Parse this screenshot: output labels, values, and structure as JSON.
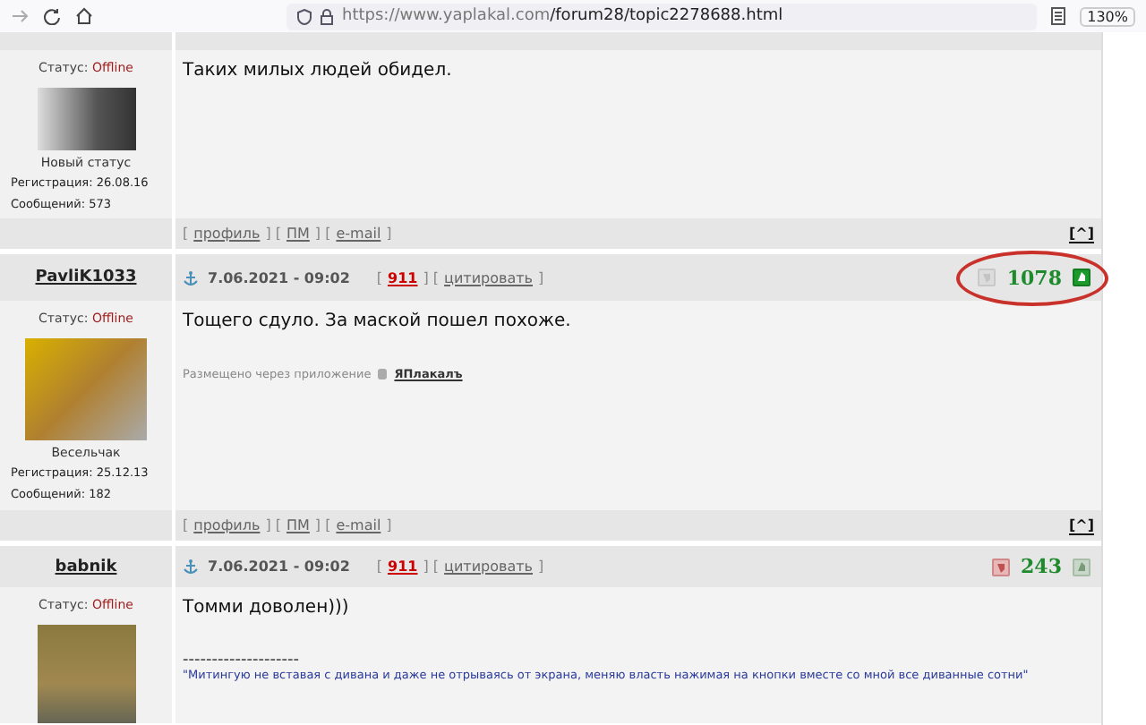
{
  "browser": {
    "url_host": "https://www.yaplakal.com",
    "url_path": "/forum28/topic2278688.html",
    "zoom": "130%"
  },
  "posts": [
    {
      "status_label": "Статус:",
      "status": "Offline",
      "avatar_caption": "Новый статус",
      "registration": "Регистрация: 26.08.16",
      "messages": "Сообщений: 573",
      "body": "Таких милых людей обидел.",
      "footer": [
        {
          "kind": "text",
          "text": "["
        },
        {
          "kind": "link",
          "text": "профиль"
        },
        {
          "kind": "text",
          "text": "] ["
        },
        {
          "kind": "link",
          "text": "ПМ"
        },
        {
          "kind": "text",
          "text": "] ["
        },
        {
          "kind": "link",
          "text": "e-mail"
        },
        {
          "kind": "text",
          "text": "]"
        }
      ],
      "top_button": "[^]"
    },
    {
      "author": "PavliK1033",
      "date": "7.06.2021 - 09:02",
      "header_links": [
        {
          "kind": "text",
          "text": "["
        },
        {
          "kind": "number",
          "text": "911"
        },
        {
          "kind": "text",
          "text": "] ["
        },
        {
          "kind": "link",
          "text": "цитировать"
        },
        {
          "kind": "text",
          "text": "]"
        }
      ],
      "rating": "1078",
      "voted_up": true,
      "circled": true,
      "status_label": "Статус:",
      "status": "Offline",
      "avatar_caption": "Весельчак",
      "registration": "Регистрация: 25.12.13",
      "messages": "Сообщений: 182",
      "body": "Тощего сдуло. За маской пошел похоже.",
      "app_note": "Размещено через приложение",
      "app_link": "ЯПлакалъ",
      "footer": [
        {
          "kind": "text",
          "text": "["
        },
        {
          "kind": "link",
          "text": "профиль"
        },
        {
          "kind": "text",
          "text": "] ["
        },
        {
          "kind": "link",
          "text": "ПМ"
        },
        {
          "kind": "text",
          "text": "] ["
        },
        {
          "kind": "link",
          "text": "e-mail"
        },
        {
          "kind": "text",
          "text": "]"
        }
      ],
      "top_button": "[^]"
    },
    {
      "author": "babnik",
      "date": "7.06.2021 - 09:02",
      "header_links": [
        {
          "kind": "text",
          "text": "["
        },
        {
          "kind": "number",
          "text": "911"
        },
        {
          "kind": "text",
          "text": "] ["
        },
        {
          "kind": "link",
          "text": "цитировать"
        },
        {
          "kind": "text",
          "text": "]"
        }
      ],
      "rating": "243",
      "voted_up": false,
      "circled": false,
      "status_label": "Статус:",
      "status": "Offline",
      "body": "Томми доволен)))",
      "signature_rule": "--------------------",
      "signature": "\"Митингую не вставая с дивана и даже не отрываясь от экрана, меняю власть нажимая на кнопки вместе со мной все диванные сотни\""
    }
  ]
}
